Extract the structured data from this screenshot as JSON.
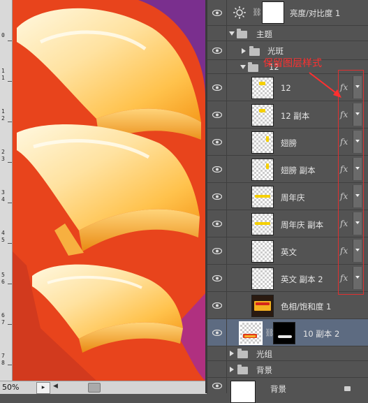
{
  "status": {
    "zoom": "50%"
  },
  "ruler": {
    "labels": [
      "0",
      "1",
      "1",
      "1",
      "2",
      "2",
      "3",
      "3",
      "4",
      "4",
      "5",
      "5",
      "6",
      "6",
      "7",
      "7",
      "8",
      "8"
    ]
  },
  "annotation": {
    "text": "保留图层样式"
  },
  "layers": [
    {
      "kind": "adjustment",
      "name": "亮度/对比度 1",
      "visible": true
    },
    {
      "kind": "group",
      "name": "主题",
      "expanded": true,
      "visible": false
    },
    {
      "kind": "group",
      "name": "光斑",
      "expanded": false,
      "visible": true
    },
    {
      "kind": "group",
      "name": "12",
      "expanded": true,
      "visible": false
    },
    {
      "kind": "layer",
      "name": "12",
      "fx": "fx",
      "visible": true
    },
    {
      "kind": "layer",
      "name": "12 副本",
      "fx": "fx",
      "visible": true
    },
    {
      "kind": "layer",
      "name": "翅膀",
      "fx": "fx",
      "visible": true
    },
    {
      "kind": "layer",
      "name": "翅膀 副本",
      "fx": "fx",
      "visible": true
    },
    {
      "kind": "layer",
      "name": "周年庆",
      "fx": "fx",
      "visible": true
    },
    {
      "kind": "layer",
      "name": "周年庆 副本",
      "fx": "fx",
      "visible": true
    },
    {
      "kind": "layer",
      "name": "英文",
      "fx": "fx",
      "visible": true
    },
    {
      "kind": "layer",
      "name": "英文 副本 2",
      "fx": "fx",
      "visible": true
    },
    {
      "kind": "adjustment",
      "name": "色相/饱和度 1",
      "visible": true
    },
    {
      "kind": "layer",
      "name": "10 副本 2",
      "selected": true,
      "visible": true
    },
    {
      "kind": "group",
      "name": "光组",
      "expanded": false,
      "visible": false
    },
    {
      "kind": "group",
      "name": "背景",
      "expanded": false,
      "visible": false
    },
    {
      "kind": "layer",
      "name": "背景",
      "visible": true
    }
  ],
  "colors": {
    "panel": "#535353",
    "selected": "#5d6b81",
    "annotation": "#ff3030",
    "art_red": "#e8401c",
    "art_gold": "#ffc35a"
  }
}
